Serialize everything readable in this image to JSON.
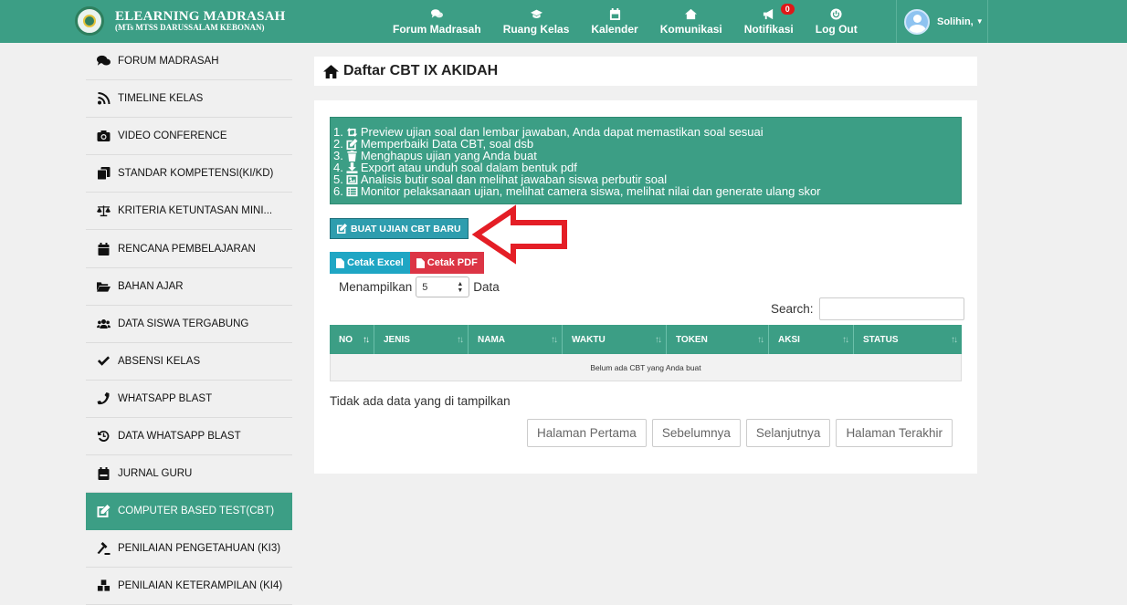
{
  "app": {
    "title": "ELEARNING MADRASAH",
    "subtitle": "(MTs MTSS DARUSSALAM KEBONAN)"
  },
  "topnav": [
    {
      "label": "Forum Madrasah",
      "icon": "comments-icon"
    },
    {
      "label": "Ruang Kelas",
      "icon": "graduation-cap-icon"
    },
    {
      "label": "Kalender",
      "icon": "calendar-icon"
    },
    {
      "label": "Komunikasi",
      "icon": "home-icon"
    },
    {
      "label": "Notifikasi",
      "icon": "bullhorn-icon",
      "badge": "0"
    },
    {
      "label": "Log Out",
      "icon": "power-icon"
    }
  ],
  "user": {
    "name": "Solihin,"
  },
  "sidebar": {
    "items": [
      {
        "label": "FORUM MADRASAH",
        "icon": "comments-icon"
      },
      {
        "label": "TIMELINE KELAS",
        "icon": "rss-icon"
      },
      {
        "label": "VIDEO CONFERENCE",
        "icon": "camera-icon"
      },
      {
        "label": "STANDAR KOMPETENSI(KI/KD)",
        "icon": "copy-icon"
      },
      {
        "label": "KRITERIA KETUNTASAN MINI...",
        "icon": "balance-scale-icon"
      },
      {
        "label": "RENCANA PEMBELAJARAN",
        "icon": "calendar-icon"
      },
      {
        "label": "BAHAN AJAR",
        "icon": "folder-open-icon"
      },
      {
        "label": "DATA SISWA TERGABUNG",
        "icon": "users-icon"
      },
      {
        "label": "ABSENSI KELAS",
        "icon": "check-icon"
      },
      {
        "label": "WHATSAPP BLAST",
        "icon": "phone-icon"
      },
      {
        "label": "DATA WHATSAPP BLAST",
        "icon": "history-icon"
      },
      {
        "label": "JURNAL GURU",
        "icon": "calendar-week-icon"
      },
      {
        "label": "COMPUTER BASED TEST(CBT)",
        "icon": "edit-icon",
        "active": true
      },
      {
        "label": "PENILAIAN PENGETAHUAN (KI3)",
        "icon": "gavel-icon"
      },
      {
        "label": "PENILAIAN KETERAMPILAN (KI4)",
        "icon": "cubes-icon"
      }
    ]
  },
  "page": {
    "title": "Daftar CBT IX AKIDAH"
  },
  "info": {
    "lines": [
      {
        "num": "1.",
        "icon": "retweet-icon",
        "text": "Preview ujian soal dan lembar jawaban, Anda dapat memastikan soal sesuai"
      },
      {
        "num": "2.",
        "icon": "edit-icon",
        "text": "Memperbaiki Data CBT, soal dsb"
      },
      {
        "num": "3.",
        "icon": "trash-icon",
        "text": "Menghapus ujian yang Anda buat"
      },
      {
        "num": "4.",
        "icon": "download-icon",
        "text": "Export atau unduh soal dalam bentuk pdf"
      },
      {
        "num": "5.",
        "icon": "image-icon",
        "text": "Analisis butir soal dan melihat jawaban siswa perbutir soal"
      },
      {
        "num": "6.",
        "icon": "list-icon",
        "text": "Monitor pelaksanaan ujian, melihat camera siswa, melihat nilai dan generate ulang skor"
      }
    ]
  },
  "buttons": {
    "new_cbt": "BUAT UJIAN CBT BARU",
    "excel": "Cetak Excel",
    "pdf": "Cetak PDF"
  },
  "length": {
    "prefix": "Menampilkan",
    "value": "5",
    "suffix": "Data"
  },
  "search": {
    "label": "Search:",
    "value": ""
  },
  "table": {
    "columns": [
      "NO",
      "JENIS",
      "NAMA",
      "WAKTU",
      "TOKEN",
      "AKSI",
      "STATUS"
    ],
    "empty": "Belum ada CBT yang Anda buat"
  },
  "footer_info": "Tidak ada data yang di tampilkan",
  "pagination": [
    "Halaman Pertama",
    "Sebelumnya",
    "Selanjutnya",
    "Halaman Terakhir"
  ],
  "colors": {
    "primary": "#3c9e85",
    "info_button": "#2e9dae",
    "excel": "#1fa6c4",
    "pdf": "#dc3545",
    "arrow": "#e41e26",
    "badge": "#e01818"
  }
}
